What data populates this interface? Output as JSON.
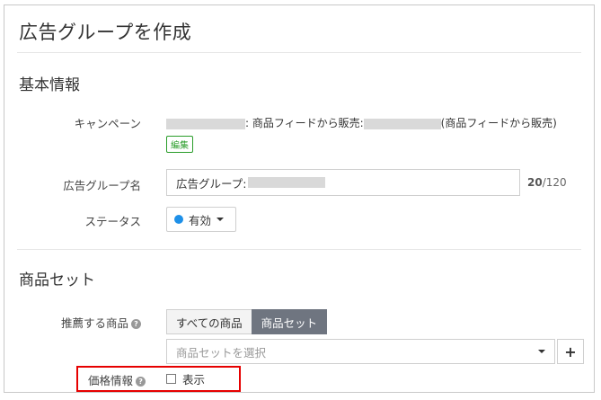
{
  "header": {
    "title": "広告グループを作成"
  },
  "basic_info": {
    "section_title": "基本情報",
    "campaign": {
      "label": "キャンペーン",
      "text_part1": ": 商品フィードから販売:",
      "text_part2": "(商品フィードから販売)",
      "edit_label": "編集"
    },
    "ad_group_name": {
      "label": "広告グループ名",
      "value_prefix": "広告グループ:",
      "count_current": "20",
      "count_max": "/120"
    },
    "status": {
      "label": "ステータス",
      "value": "有効",
      "dot_color": "#1e90e8"
    }
  },
  "product_set": {
    "section_title": "商品セット",
    "recommended": {
      "label": "推薦する商品",
      "options": [
        "すべての商品",
        "商品セット"
      ],
      "selected": "商品セット"
    },
    "select_placeholder": "商品セットを選択",
    "add_symbol": "+",
    "price_info": {
      "label": "価格情報",
      "checkbox_label": "表示",
      "checked": false
    }
  },
  "help_symbol": "?",
  "accent_colors": {
    "highlight": "#e60000",
    "edit": "#2a9d2a",
    "active_segment": "#6f7580"
  }
}
